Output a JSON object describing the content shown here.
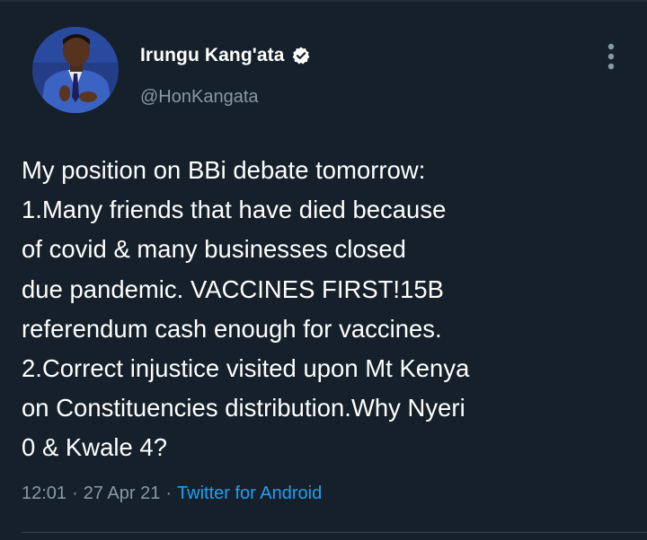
{
  "tweet": {
    "author": {
      "display_name": "Irungu Kang'ata",
      "handle": "@HonKangata",
      "verified": true,
      "avatar_icon": "profile-photo"
    },
    "text": "My position on BBi debate tomorrow:\n1.Many friends that have died because\nof covid & many businesses closed\ndue pandemic. VACCINES FIRST!15B\nreferendum cash enough for vaccines.\n2.Correct injustice visited upon Mt Kenya\non Constituencies distribution.Why Nyeri\n0 & Kwale 4?",
    "time": "12:01",
    "date": "27 Apr 21",
    "separator": "·",
    "source": "Twitter for Android",
    "more_icon": "more-vertical-icon"
  },
  "colors": {
    "background": "#15202b",
    "primary_text": "#ffffff",
    "secondary_text": "#8899a6",
    "link": "#1da1f2",
    "divider": "#38444d"
  }
}
